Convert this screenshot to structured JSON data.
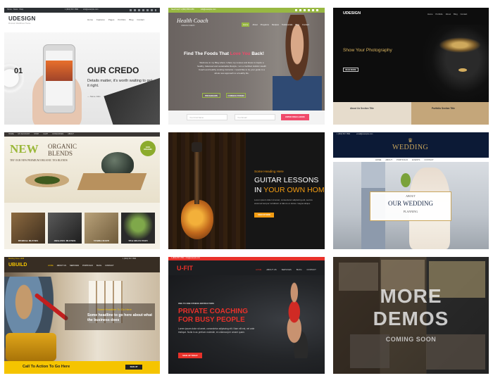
{
  "demos": {
    "udesign": {
      "topbar_left": "Home · News · Shop",
      "topbar_phone": "1 (800) 567-7890",
      "topbar_email": "info@example.com",
      "logo": "UDESIGN",
      "tagline": "Premium WordPress Theme",
      "nav": [
        "Home",
        "Features",
        "Pages",
        "Portfolio",
        "Blog",
        "Contact"
      ],
      "slide_number": "01",
      "headline": "OUR CREDO",
      "body": "Details matter, it's worth waiting to get it right.",
      "signature": "— Steve Jobs"
    },
    "health_coach": {
      "topbar_left": "Need help? 1 (800) 555-0150",
      "topbar_email": "info@example.com",
      "logo": "Health Coach",
      "logo_sub": "UDESIGN DEMO",
      "nav": [
        "Home",
        "About",
        "Programs",
        "Recipes",
        "Testimonials",
        "Blog",
        "Contact"
      ],
      "headline_part1": "Find The Foods That",
      "headline_accent": "Love You",
      "headline_part2": "Back!",
      "body": "Welcome to my Blog where I share my recipes and ideas to inspire a healthy, balanced and sustainable lifestyle. I am a Certified Holistic Health Coach and healthy cooking instructor. I would like to be your guide to a whole new approach to a healthy life.",
      "btn_programs": "PROGRAMS",
      "btn_consult": "CONSULTATION",
      "field_name": "Your First Name",
      "field_email": "Your Email",
      "btn_submit": "ENTER FREE E-BOOK"
    },
    "photography": {
      "logo": "UDESIGN",
      "nav": [
        "Home",
        "Portfolio",
        "About",
        "Blog",
        "Contact"
      ],
      "headline": "Show Your Photography",
      "button": "READ MORE",
      "footer_left": "About Us Section Title",
      "footer_right": "Portfolio Section Title"
    },
    "tea": {
      "nav": [
        "HOME",
        "MY ACCOUNT",
        "SHOP",
        "CART",
        "CATEGORIES",
        "ABOUT"
      ],
      "new_word": "NEW",
      "title_line1": "ORGANIC",
      "title_line2": "BLENDS",
      "subtitle": "TRY OUR NEW PREMIUM ORGANIC TEA BLENDS",
      "seal": "100% ORGANIC",
      "categories": [
        "HERBAL BLENDS",
        "ORGANIC BLENDS",
        "YERBA MATE",
        "TEA SELECTION"
      ]
    },
    "guitar": {
      "kicker": "Some Heading Here",
      "headline_line1": "GUITAR LESSONS",
      "headline_prefix": "IN ",
      "headline_accent": "YOUR OWN HOME",
      "body": "Lorem ipsum dolor sit amet, consectetur adipiscing elit, sed do eiusmod tempor incididunt ut labore et dolore magna aliqua.",
      "button": "SIGN UP NOW"
    },
    "wedding": {
      "topbar_phone": "1 (800) 567-7890",
      "topbar_email": "email@example.com",
      "logo": "WEDDING",
      "nav": [
        "HOME",
        "ABOUT",
        "PORTFOLIO",
        "EVENTS",
        "CONTACT"
      ],
      "about": "ABOUT",
      "headline": "OUR WEDDING",
      "sub": "PLANNING"
    },
    "ubuild": {
      "topbar": "Building Since 1988",
      "phone": "1 (800) 567-7890",
      "logo": "UBUILD",
      "nav": [
        "HOME",
        "ABOUT US",
        "SERVICES",
        "PORTFOLIO",
        "BLOG",
        "CONTACT"
      ],
      "kicker": "Some Headline To Go Here",
      "headline": "Some headline to go here about what the business does",
      "cta": "Call To Action To Go Here",
      "cta_button": "SIGN UP"
    },
    "ufit": {
      "topbar": "1 (800) 567-7890 · info@example.com",
      "logo": "U-FIT",
      "nav": [
        "HOME",
        "ABOUT US",
        "SERVICES",
        "BLOG",
        "CONTACT"
      ],
      "kicker": "ONE TO ONE FITNESS INSTRUCTORS",
      "headline_line1": "PRIVATE COACHING",
      "headline_line2": "FOR BUSY PEOPLE",
      "body": "Lorem ipsum dolor sit amet, consectetur adipiscing elit. Nam elit est, vel ante tristique. Nulla in ac pretium molestie, en ullamcorper ornare quam.",
      "button": "SIGN UP TODAY"
    },
    "more": {
      "line1": "MORE",
      "line2": "DEMOS",
      "sub": "COMING SOON"
    }
  },
  "colors": {
    "health_green": "#98b842",
    "health_pink": "#f0496a",
    "gold": "#c9a55b",
    "orange": "#f39c12",
    "ufit_red": "#e8312a",
    "ubuild_yellow": "#f5c400",
    "tea_green": "#8cab2c"
  }
}
